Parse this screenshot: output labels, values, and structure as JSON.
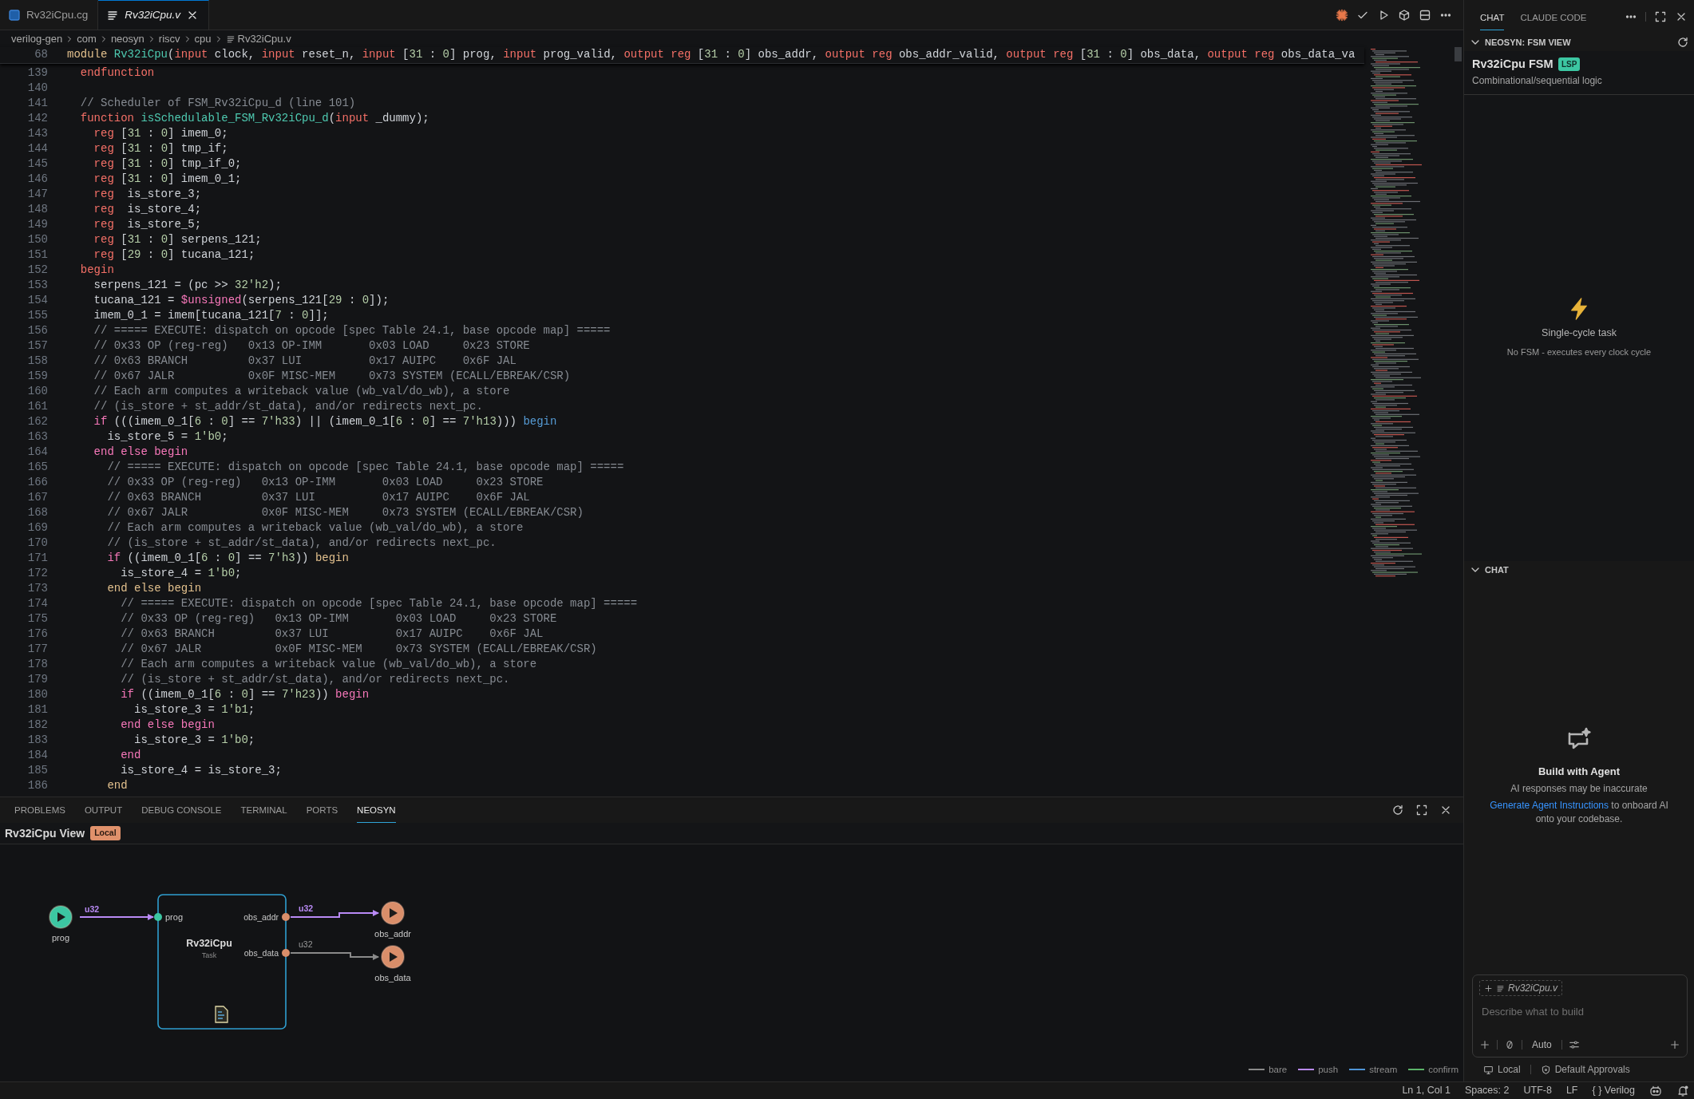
{
  "editor_tabs": [
    {
      "label": "Rv32iCpu.cg",
      "kind": "cg",
      "selected": false
    },
    {
      "label": "Rv32iCpu.v",
      "kind": "verilog",
      "selected": true
    }
  ],
  "breadcrumb": [
    "verilog-gen",
    "com",
    "neosyn",
    "riscv",
    "cpu",
    "Rv32iCpu.v"
  ],
  "sticky_line": {
    "number": "68",
    "segments": [
      {
        "kind": "control",
        "text": "module "
      },
      {
        "kind": "name",
        "text": "Rv32iCpu"
      },
      {
        "kind": "plain",
        "text": "("
      },
      {
        "kind": "keyword",
        "text": "input"
      },
      {
        "kind": "plain",
        "text": " clock, "
      },
      {
        "kind": "keyword",
        "text": "input"
      },
      {
        "kind": "plain",
        "text": " reset_n, "
      },
      {
        "kind": "keyword",
        "text": "input"
      },
      {
        "kind": "plain",
        "text": " ["
      },
      {
        "kind": "number",
        "text": "31"
      },
      {
        "kind": "plain",
        "text": " : "
      },
      {
        "kind": "number",
        "text": "0"
      },
      {
        "kind": "plain",
        "text": "] prog, "
      },
      {
        "kind": "keyword",
        "text": "input"
      },
      {
        "kind": "plain",
        "text": " prog_valid, "
      },
      {
        "kind": "keyword",
        "text": "output reg"
      },
      {
        "kind": "plain",
        "text": " ["
      },
      {
        "kind": "number",
        "text": "31"
      },
      {
        "kind": "plain",
        "text": " : "
      },
      {
        "kind": "number",
        "text": "0"
      },
      {
        "kind": "plain",
        "text": "] obs_addr, "
      },
      {
        "kind": "keyword",
        "text": "output reg"
      },
      {
        "kind": "plain",
        "text": " obs_addr_valid, "
      },
      {
        "kind": "keyword",
        "text": "output reg"
      },
      {
        "kind": "plain",
        "text": " ["
      },
      {
        "kind": "number",
        "text": "31"
      },
      {
        "kind": "plain",
        "text": " : "
      },
      {
        "kind": "number",
        "text": "0"
      },
      {
        "kind": "plain",
        "text": "] obs_data, "
      },
      {
        "kind": "keyword",
        "text": "output reg"
      },
      {
        "kind": "plain",
        "text": " obs_data_va"
      }
    ]
  },
  "code_lines": [
    {
      "number": "139",
      "segments": [
        {
          "kind": "keyword",
          "text": "  endfunction"
        }
      ]
    },
    {
      "number": "140"
    },
    {
      "number": "141",
      "segments": [
        {
          "kind": "comment",
          "text": "  // Scheduler of FSM_Rv32iCpu_d (line 101)"
        }
      ]
    },
    {
      "number": "142",
      "segments": [
        {
          "kind": "keyword",
          "text": "  function "
        },
        {
          "kind": "name",
          "text": "isSchedulable_FSM_Rv32iCpu_d"
        },
        {
          "kind": "plain",
          "text": "("
        },
        {
          "kind": "keyword",
          "text": "input"
        },
        {
          "kind": "plain",
          "text": " _dummy);"
        }
      ]
    },
    {
      "number": "143",
      "segments": [
        {
          "kind": "keyword",
          "text": "    reg"
        },
        {
          "kind": "plain",
          "text": " ["
        },
        {
          "kind": "number",
          "text": "31"
        },
        {
          "kind": "plain",
          "text": " : "
        },
        {
          "kind": "number",
          "text": "0"
        },
        {
          "kind": "plain",
          "text": "] imem_0;"
        }
      ]
    },
    {
      "number": "144",
      "segments": [
        {
          "kind": "keyword",
          "text": "    reg"
        },
        {
          "kind": "plain",
          "text": " ["
        },
        {
          "kind": "number",
          "text": "31"
        },
        {
          "kind": "plain",
          "text": " : "
        },
        {
          "kind": "number",
          "text": "0"
        },
        {
          "kind": "plain",
          "text": "] tmp_if;"
        }
      ]
    },
    {
      "number": "145",
      "segments": [
        {
          "kind": "keyword",
          "text": "    reg"
        },
        {
          "kind": "plain",
          "text": " ["
        },
        {
          "kind": "number",
          "text": "31"
        },
        {
          "kind": "plain",
          "text": " : "
        },
        {
          "kind": "number",
          "text": "0"
        },
        {
          "kind": "plain",
          "text": "] tmp_if_0;"
        }
      ]
    },
    {
      "number": "146",
      "segments": [
        {
          "kind": "keyword",
          "text": "    reg"
        },
        {
          "kind": "plain",
          "text": " ["
        },
        {
          "kind": "number",
          "text": "31"
        },
        {
          "kind": "plain",
          "text": " : "
        },
        {
          "kind": "number",
          "text": "0"
        },
        {
          "kind": "plain",
          "text": "] imem_0_1;"
        }
      ]
    },
    {
      "number": "147",
      "segments": [
        {
          "kind": "keyword",
          "text": "    reg"
        },
        {
          "kind": "plain",
          "text": "  is_store_3;"
        }
      ]
    },
    {
      "number": "148",
      "segments": [
        {
          "kind": "keyword",
          "text": "    reg"
        },
        {
          "kind": "plain",
          "text": "  is_store_4;"
        }
      ]
    },
    {
      "number": "149",
      "segments": [
        {
          "kind": "keyword",
          "text": "    reg"
        },
        {
          "kind": "plain",
          "text": "  is_store_5;"
        }
      ]
    },
    {
      "number": "150",
      "segments": [
        {
          "kind": "keyword",
          "text": "    reg"
        },
        {
          "kind": "plain",
          "text": " ["
        },
        {
          "kind": "number",
          "text": "31"
        },
        {
          "kind": "plain",
          "text": " : "
        },
        {
          "kind": "number",
          "text": "0"
        },
        {
          "kind": "plain",
          "text": "] serpens_121;"
        }
      ]
    },
    {
      "number": "151",
      "segments": [
        {
          "kind": "keyword",
          "text": "    reg"
        },
        {
          "kind": "plain",
          "text": " ["
        },
        {
          "kind": "number",
          "text": "29"
        },
        {
          "kind": "plain",
          "text": " : "
        },
        {
          "kind": "number",
          "text": "0"
        },
        {
          "kind": "plain",
          "text": "] tucana_121;"
        }
      ]
    },
    {
      "number": "152",
      "segments": [
        {
          "kind": "keyword",
          "text": "  begin"
        }
      ]
    },
    {
      "number": "153",
      "segments": [
        {
          "kind": "plain",
          "text": "    serpens_121 = (pc >> "
        },
        {
          "kind": "number",
          "text": "32'h2"
        },
        {
          "kind": "plain",
          "text": ");"
        }
      ]
    },
    {
      "number": "154",
      "segments": [
        {
          "kind": "plain",
          "text": "    tucana_121 = "
        },
        {
          "kind": "builtin",
          "text": "$unsigned"
        },
        {
          "kind": "plain",
          "text": "(serpens_121["
        },
        {
          "kind": "number",
          "text": "29"
        },
        {
          "kind": "plain",
          "text": " : "
        },
        {
          "kind": "number",
          "text": "0"
        },
        {
          "kind": "plain",
          "text": "]);"
        }
      ]
    },
    {
      "number": "155",
      "segments": [
        {
          "kind": "plain",
          "text": "    imem_0_1 = imem[tucana_121["
        },
        {
          "kind": "number",
          "text": "7"
        },
        {
          "kind": "plain",
          "text": " : "
        },
        {
          "kind": "number",
          "text": "0"
        },
        {
          "kind": "plain",
          "text": "]];"
        }
      ]
    },
    {
      "number": "156",
      "segments": [
        {
          "kind": "comment",
          "text": "    // ===== EXECUTE: dispatch on opcode [spec Table 24.1, base opcode map] ====="
        }
      ]
    },
    {
      "number": "157",
      "segments": [
        {
          "kind": "comment",
          "text": "    // 0x33 OP (reg-reg)   0x13 OP-IMM       0x03 LOAD     0x23 STORE"
        }
      ]
    },
    {
      "number": "158",
      "segments": [
        {
          "kind": "comment",
          "text": "    // 0x63 BRANCH         0x37 LUI          0x17 AUIPC    0x6F JAL"
        }
      ]
    },
    {
      "number": "159",
      "segments": [
        {
          "kind": "comment",
          "text": "    // 0x67 JALR           0x0F MISC-MEM     0x73 SYSTEM (ECALL/EBREAK/CSR)"
        }
      ]
    },
    {
      "number": "160",
      "segments": [
        {
          "kind": "comment",
          "text": "    // Each arm computes a writeback value (wb_val/do_wb), a store"
        }
      ]
    },
    {
      "number": "161",
      "segments": [
        {
          "kind": "comment",
          "text": "    // (is_store + st_addr/st_data), and/or redirects next_pc."
        }
      ]
    },
    {
      "number": "162",
      "segments": [
        {
          "kind": "builtin",
          "text": "    if"
        },
        {
          "kind": "plain",
          "text": " (((imem_0_1["
        },
        {
          "kind": "number",
          "text": "6"
        },
        {
          "kind": "plain",
          "text": " : "
        },
        {
          "kind": "number",
          "text": "0"
        },
        {
          "kind": "plain",
          "text": "] == "
        },
        {
          "kind": "number",
          "text": "7'h33"
        },
        {
          "kind": "plain",
          "text": ") || (imem_0_1["
        },
        {
          "kind": "number",
          "text": "6"
        },
        {
          "kind": "plain",
          "text": " : "
        },
        {
          "kind": "number",
          "text": "0"
        },
        {
          "kind": "plain",
          "text": "] == "
        },
        {
          "kind": "number",
          "text": "7'h13"
        },
        {
          "kind": "plain",
          "text": ")))"
        },
        {
          "kind": "block",
          "text": " begin"
        }
      ]
    },
    {
      "number": "163",
      "segments": [
        {
          "kind": "plain",
          "text": "      is_store_5 = "
        },
        {
          "kind": "number",
          "text": "1'b0"
        },
        {
          "kind": "plain",
          "text": ";"
        }
      ]
    },
    {
      "number": "164",
      "segments": [
        {
          "kind": "builtin",
          "text": "    end else begin"
        }
      ]
    },
    {
      "number": "165",
      "segments": [
        {
          "kind": "comment",
          "text": "      // ===== EXECUTE: dispatch on opcode [spec Table 24.1, base opcode map] ====="
        }
      ]
    },
    {
      "number": "166",
      "segments": [
        {
          "kind": "comment",
          "text": "      // 0x33 OP (reg-reg)   0x13 OP-IMM       0x03 LOAD     0x23 STORE"
        }
      ]
    },
    {
      "number": "167",
      "segments": [
        {
          "kind": "comment",
          "text": "      // 0x63 BRANCH         0x37 LUI          0x17 AUIPC    0x6F JAL"
        }
      ]
    },
    {
      "number": "168",
      "segments": [
        {
          "kind": "comment",
          "text": "      // 0x67 JALR           0x0F MISC-MEM     0x73 SYSTEM (ECALL/EBREAK/CSR)"
        }
      ]
    },
    {
      "number": "169",
      "segments": [
        {
          "kind": "comment",
          "text": "      // Each arm computes a writeback value (wb_val/do_wb), a store"
        }
      ]
    },
    {
      "number": "170",
      "segments": [
        {
          "kind": "comment",
          "text": "      // (is_store + st_addr/st_data), and/or redirects next_pc."
        }
      ]
    },
    {
      "number": "171",
      "segments": [
        {
          "kind": "builtin",
          "text": "      if"
        },
        {
          "kind": "plain",
          "text": " ((imem_0_1["
        },
        {
          "kind": "number",
          "text": "6"
        },
        {
          "kind": "plain",
          "text": " : "
        },
        {
          "kind": "number",
          "text": "0"
        },
        {
          "kind": "plain",
          "text": "] == "
        },
        {
          "kind": "number",
          "text": "7'h3"
        },
        {
          "kind": "plain",
          "text": "))"
        },
        {
          "kind": "control",
          "text": " begin"
        }
      ]
    },
    {
      "number": "172",
      "segments": [
        {
          "kind": "plain",
          "text": "        is_store_4 = "
        },
        {
          "kind": "number",
          "text": "1'b0"
        },
        {
          "kind": "plain",
          "text": ";"
        }
      ]
    },
    {
      "number": "173",
      "segments": [
        {
          "kind": "control",
          "text": "      end else begin"
        }
      ]
    },
    {
      "number": "174",
      "segments": [
        {
          "kind": "comment",
          "text": "        // ===== EXECUTE: dispatch on opcode [spec Table 24.1, base opcode map] ====="
        }
      ]
    },
    {
      "number": "175",
      "segments": [
        {
          "kind": "comment",
          "text": "        // 0x33 OP (reg-reg)   0x13 OP-IMM       0x03 LOAD     0x23 STORE"
        }
      ]
    },
    {
      "number": "176",
      "segments": [
        {
          "kind": "comment",
          "text": "        // 0x63 BRANCH         0x37 LUI          0x17 AUIPC    0x6F JAL"
        }
      ]
    },
    {
      "number": "177",
      "segments": [
        {
          "kind": "comment",
          "text": "        // 0x67 JALR           0x0F MISC-MEM     0x73 SYSTEM (ECALL/EBREAK/CSR)"
        }
      ]
    },
    {
      "number": "178",
      "segments": [
        {
          "kind": "comment",
          "text": "        // Each arm computes a writeback value (wb_val/do_wb), a store"
        }
      ]
    },
    {
      "number": "179",
      "segments": [
        {
          "kind": "comment",
          "text": "        // (is_store + st_addr/st_data), and/or redirects next_pc."
        }
      ]
    },
    {
      "number": "180",
      "segments": [
        {
          "kind": "builtin",
          "text": "        if"
        },
        {
          "kind": "plain",
          "text": " ((imem_0_1["
        },
        {
          "kind": "number",
          "text": "6"
        },
        {
          "kind": "plain",
          "text": " : "
        },
        {
          "kind": "number",
          "text": "0"
        },
        {
          "kind": "plain",
          "text": "] == "
        },
        {
          "kind": "number",
          "text": "7'h23"
        },
        {
          "kind": "plain",
          "text": "))"
        },
        {
          "kind": "builtin",
          "text": " begin"
        }
      ]
    },
    {
      "number": "181",
      "segments": [
        {
          "kind": "plain",
          "text": "          is_store_3 = "
        },
        {
          "kind": "number",
          "text": "1'b1"
        },
        {
          "kind": "plain",
          "text": ";"
        }
      ]
    },
    {
      "number": "182",
      "segments": [
        {
          "kind": "builtin",
          "text": "        end else begin"
        }
      ]
    },
    {
      "number": "183",
      "segments": [
        {
          "kind": "plain",
          "text": "          is_store_3 = "
        },
        {
          "kind": "number",
          "text": "1'b0"
        },
        {
          "kind": "plain",
          "text": ";"
        }
      ]
    },
    {
      "number": "184",
      "segments": [
        {
          "kind": "builtin",
          "text": "        end"
        }
      ]
    },
    {
      "number": "185",
      "segments": [
        {
          "kind": "plain",
          "text": "        is_store_4 = is_store_3;"
        }
      ]
    },
    {
      "number": "186",
      "segments": [
        {
          "kind": "control",
          "text": "      end"
        }
      ]
    }
  ],
  "panel_tabs": [
    {
      "label": "PROBLEMS",
      "selected": false
    },
    {
      "label": "OUTPUT",
      "selected": false
    },
    {
      "label": "DEBUG CONSOLE",
      "selected": false
    },
    {
      "label": "TERMINAL",
      "selected": false
    },
    {
      "label": "PORTS",
      "selected": false
    },
    {
      "label": "NEOSYN",
      "selected": true
    }
  ],
  "diagram": {
    "title": "Rv32iCpu View",
    "badge": "Local",
    "inputs": [
      {
        "label": "prog",
        "edge": {
          "label": "u32",
          "kind": "push"
        }
      }
    ],
    "module": {
      "name": "Rv32iCpu",
      "subtitle": "Task",
      "in_ports": [
        "prog"
      ],
      "out_ports": [
        "obs_addr",
        "obs_data"
      ]
    },
    "outputs": [
      {
        "label": "obs_addr",
        "edge": {
          "label": "u32",
          "kind": "push"
        }
      },
      {
        "label": "obs_data",
        "edge": {
          "label": "u32",
          "kind": "bare"
        }
      }
    ],
    "legend": [
      {
        "label": "bare",
        "kind": "bare",
        "color": "#8a8a8a"
      },
      {
        "label": "push",
        "kind": "push",
        "color": "#b98af5"
      },
      {
        "label": "stream",
        "kind": "stream",
        "color": "#4f95d8"
      },
      {
        "label": "confirm",
        "kind": "confirm",
        "color": "#5cb56a"
      }
    ]
  },
  "right_panel": {
    "tabs": [
      {
        "label": "CHAT",
        "selected": true
      },
      {
        "label": "CLAUDE CODE",
        "selected": false
      }
    ],
    "fsm_view": {
      "header": "NEOSYN: FSM VIEW",
      "title": "Rv32iCpu FSM",
      "badge": "LSP",
      "subtitle": "Combinational/sequential logic",
      "empty_title": "Single-cycle task",
      "empty_text": "No FSM - executes every clock cycle"
    },
    "chat": {
      "header": "CHAT",
      "empty_title": "Build with Agent",
      "disclaimer": "AI responses may be inaccurate",
      "link": "Generate Agent Instructions",
      "link_after": " to onboard AI onto your codebase.",
      "context_file": "Rv32iCpu.v",
      "placeholder": "Describe what to build",
      "mode": "Auto",
      "footer": [
        {
          "label": "Local",
          "kind": "monitor"
        },
        {
          "label": "Default Approvals",
          "kind": "shield"
        }
      ]
    }
  },
  "status_bar": [
    "Ln 1, Col 1",
    "Spaces: 2",
    "UTF-8",
    "LF",
    "{ } Verilog"
  ]
}
